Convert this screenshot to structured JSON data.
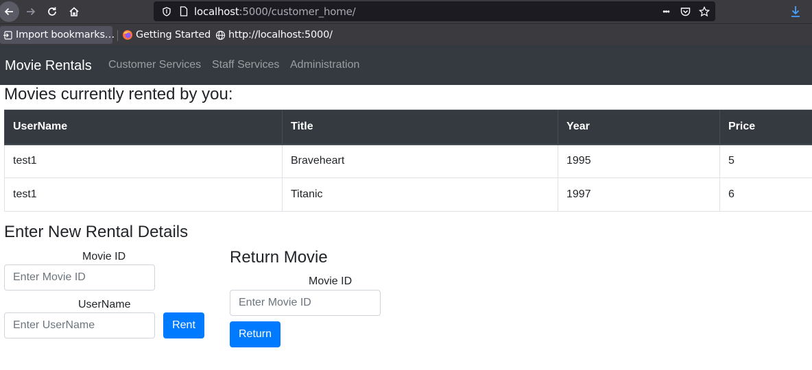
{
  "browser": {
    "url_host": "localhost",
    "url_rest": ":5000/customer_home/",
    "more_icon": "•••",
    "bookmarks": [
      {
        "label": "Import bookmarks…"
      },
      {
        "label": "Getting Started"
      },
      {
        "label": "http://localhost:5000/"
      }
    ]
  },
  "navbar": {
    "brand": "Movie Rentals",
    "links": [
      "Customer Services",
      "Staff Services",
      "Administration"
    ]
  },
  "rented": {
    "heading": "Movies currently rented by you:",
    "columns": [
      "UserName",
      "Title",
      "Year",
      "Price"
    ],
    "rows": [
      [
        "test1",
        "Braveheart",
        "1995",
        "5"
      ],
      [
        "test1",
        "Titanic",
        "1997",
        "6"
      ]
    ]
  },
  "rent_form": {
    "title": "Enter New Rental Details",
    "movie_id_label": "Movie ID",
    "movie_id_placeholder": "Enter Movie ID",
    "username_label": "UserName",
    "username_placeholder": "Enter UserName",
    "submit_label": "Rent"
  },
  "return_form": {
    "title": "Return Movie",
    "movie_id_label": "Movie ID",
    "movie_id_placeholder": "Enter Movie ID",
    "submit_label": "Return"
  },
  "colors": {
    "navbar_bg": "#343a40",
    "primary": "#007bff",
    "chrome_bg": "#3b3b3f",
    "download_accent": "#45a1ff"
  }
}
